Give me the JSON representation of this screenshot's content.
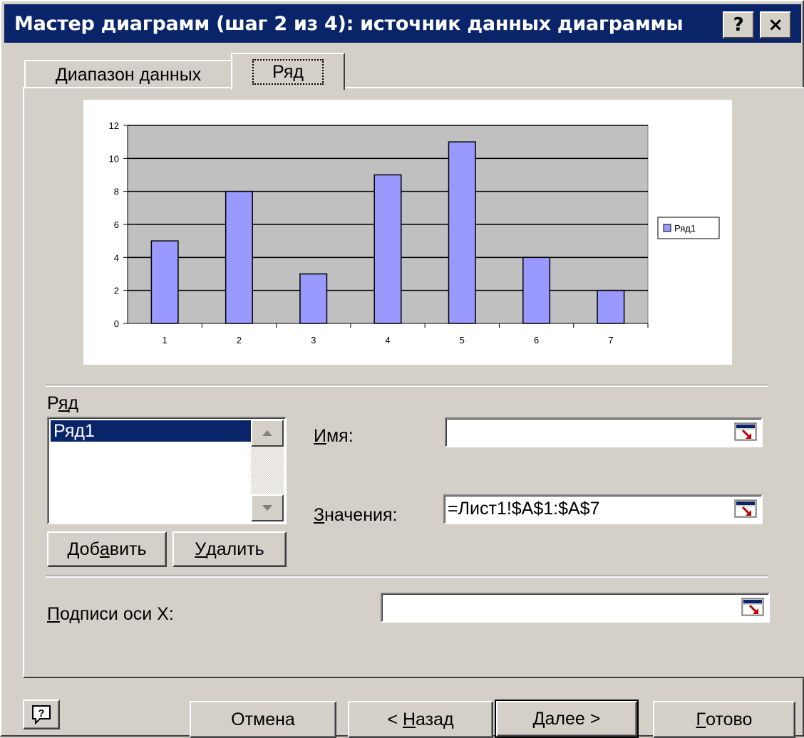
{
  "window": {
    "title": "Мастер диаграмм (шаг 2 из 4): источник данных диаграммы",
    "help_button": "?",
    "close_button": "×"
  },
  "tabs": [
    {
      "label": "Диапазон данных",
      "active": false
    },
    {
      "label": "Ряд",
      "active": true
    }
  ],
  "chart_data": {
    "type": "bar",
    "categories": [
      "1",
      "2",
      "3",
      "4",
      "5",
      "6",
      "7"
    ],
    "series": [
      {
        "name": "Ряд1",
        "values": [
          5,
          8,
          3,
          9,
          11,
          4,
          2
        ],
        "color": "#9999ff"
      }
    ],
    "ylim": [
      0,
      12
    ],
    "yticks": [
      0,
      2,
      4,
      6,
      8,
      10,
      12
    ],
    "grid": true,
    "legend": "right",
    "plot_bg": "#c0c0c0"
  },
  "series_section": {
    "label_pre": "Р",
    "label_u": "я",
    "label_post": "д",
    "items": [
      "Ряд1"
    ],
    "selected": "Ряд1"
  },
  "name_field": {
    "label_u": "И",
    "label_rest": "мя:",
    "value": ""
  },
  "values_field": {
    "label_u": "З",
    "label_rest": "начения:",
    "value": "=Лист1!$A$1:$A$7"
  },
  "add_button": {
    "pre": "Доб",
    "u": "а",
    "post": "вить"
  },
  "delete_button": {
    "pre": "",
    "u": "У",
    "post": "далить"
  },
  "xlabels_field": {
    "label_u": "П",
    "label_rest": "одписи оси X:",
    "value": ""
  },
  "footer": {
    "cancel": "Отмена",
    "back_pre": "< ",
    "back_u": "Н",
    "back_post": "азад",
    "next_u": "Д",
    "next_post": "алее >",
    "finish_u": "Г",
    "finish_post": "отово"
  },
  "colors": {
    "titlebar": "#0a246a",
    "selection": "#0a246a",
    "face": "#d4d0c8"
  }
}
